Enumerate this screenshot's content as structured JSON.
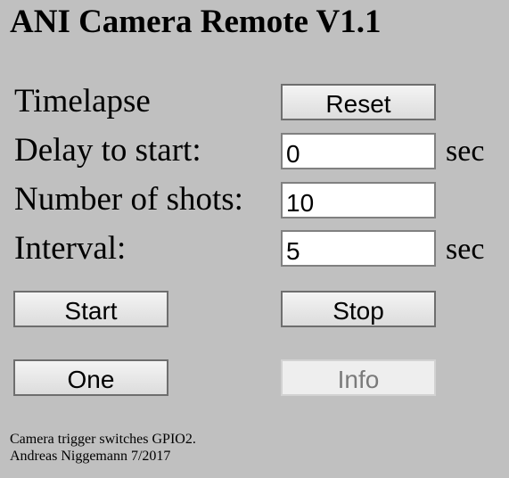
{
  "page": {
    "title": "ANI Camera Remote V1.1"
  },
  "timelapse": {
    "label": "Timelapse",
    "reset_label": "Reset",
    "delay_label": "Delay to start:",
    "delay_value": "0",
    "delay_unit": "sec",
    "shots_label": "Number of shots:",
    "shots_value": "10",
    "interval_label": "Interval:",
    "interval_value": "5",
    "interval_unit": "sec"
  },
  "controls": {
    "start_label": "Start",
    "stop_label": "Stop",
    "one_label": "One",
    "info_label": "Info",
    "info_disabled": true
  },
  "footer": {
    "line1": "Camera trigger switches GPIO2.",
    "line2": "Andreas Niggemann 7/2017"
  }
}
